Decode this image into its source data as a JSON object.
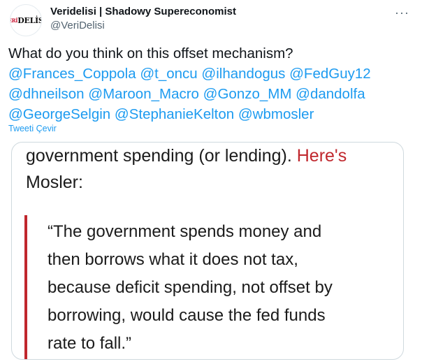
{
  "author": {
    "display_name": "Veridelisi | Shadowy Supereconomist",
    "handle": "@VeriDelisi",
    "avatar_logo_prefix": "VERİ",
    "avatar_logo_main": "DELİSİ",
    "more_icon": "more-horizontal-icon"
  },
  "tweet": {
    "line1": "What do you think on this offset  mechanism?",
    "line2": [
      "@Frances_Coppola",
      "@t_oncu",
      "@ilhandogus",
      "@FedGuy12"
    ],
    "line3": [
      "@dhneilson",
      "@Maroon_Macro",
      "@Gonzo_MM",
      "@dandolfa"
    ],
    "line4": [
      "@GeorgeSelgin",
      "@StephanieKelton",
      "@wbmosler"
    ],
    "translate_label": "Tweeti Çevir"
  },
  "media": {
    "para_line1_text": "government spending (or lending).",
    "para_line1_link": "Here's",
    "para_line2": "Mosler:",
    "quote_lines": [
      "“The government spends money and",
      "then borrows what it does not tax,",
      "because deficit spending, not offset by",
      "borrowing, would cause the fed funds",
      "rate to fall.”"
    ],
    "accent_color": "#c0272d"
  },
  "colors": {
    "mention": "#1d9bf0",
    "text": "#0f1419",
    "muted": "#536471"
  }
}
